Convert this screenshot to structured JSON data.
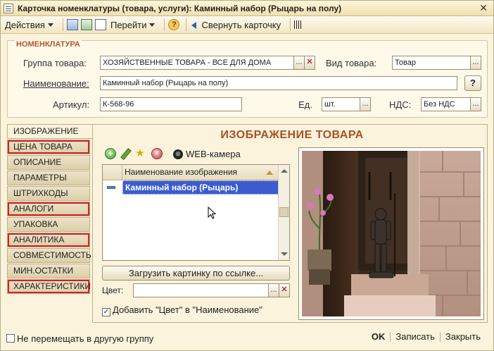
{
  "window": {
    "title": "Карточка номенклатуры (товара, услуги): Каминный набор (Рыцарь на полу)",
    "close_glyph": "✕"
  },
  "toolbar": {
    "actions_label": "Действия",
    "goto_label": "Перейти",
    "help_glyph": "?",
    "collapse_label": "Свернуть карточку"
  },
  "nomenclature": {
    "section_title": "НОМЕНКЛАТУРА",
    "group_label": "Группа товара:",
    "group_value": "ХОЗЯЙСТВЕННЫЕ ТОВАРА - ВСЕ ДЛЯ ДОМА",
    "kind_label": "Вид товара:",
    "kind_value": "Товар",
    "name_label": "Наименование:",
    "name_value": "Каминный набор (Рыцарь на полу)",
    "article_label": "Артикул:",
    "article_value": "К-568-96",
    "unit_label": "Ед.",
    "unit_value": "шт.",
    "vat_label": "НДС:",
    "vat_value": "Без НДС",
    "select_btn": "...",
    "clear_btn": "✕",
    "help_btn": "?"
  },
  "tabs": [
    {
      "label": "ИЗОБРАЖЕНИЕ",
      "active": true,
      "highlighted": false
    },
    {
      "label": "ЦЕНА ТОВАРА",
      "active": false,
      "highlighted": true
    },
    {
      "label": "ОПИСАНИЕ",
      "active": false,
      "highlighted": false
    },
    {
      "label": "ПАРАМЕТРЫ",
      "active": false,
      "highlighted": false
    },
    {
      "label": "ШТРИХКОДЫ",
      "active": false,
      "highlighted": false
    },
    {
      "label": "АНАЛОГИ",
      "active": false,
      "highlighted": true
    },
    {
      "label": "УПАКОВКА",
      "active": false,
      "highlighted": false
    },
    {
      "label": "АНАЛИТИКА",
      "active": false,
      "highlighted": true
    },
    {
      "label": "СОВМЕСТИМОСТЬ",
      "active": false,
      "highlighted": false
    },
    {
      "label": "МИН.ОСТАТКИ",
      "active": false,
      "highlighted": false
    },
    {
      "label": "ХАРАКТЕРИСТИКИ",
      "active": false,
      "highlighted": true
    }
  ],
  "image_panel": {
    "title": "ИЗОБРАЖЕНИЕ ТОВАРА",
    "webcam_label": "WEB-камера",
    "list_header": "Наименование изображения",
    "rows": [
      "Каминный набор (Рыцарь)"
    ],
    "load_button": "Загрузить картинку по ссылке...",
    "color_label": "Цвет:",
    "color_value": "",
    "add_color_label": "Добавить \"Цвет\" в \"Наименование\"",
    "add_color_checked": true
  },
  "footer": {
    "no_move_label": "Не перемещать в другую группу",
    "ok_label": "OK",
    "save_label": "Записать",
    "close_label": "Закрыть"
  },
  "colors": {
    "accent": "#a85026",
    "highlight_outline": "#d6202a",
    "selection": "#3b5ccc",
    "background": "#fbf3dc"
  }
}
